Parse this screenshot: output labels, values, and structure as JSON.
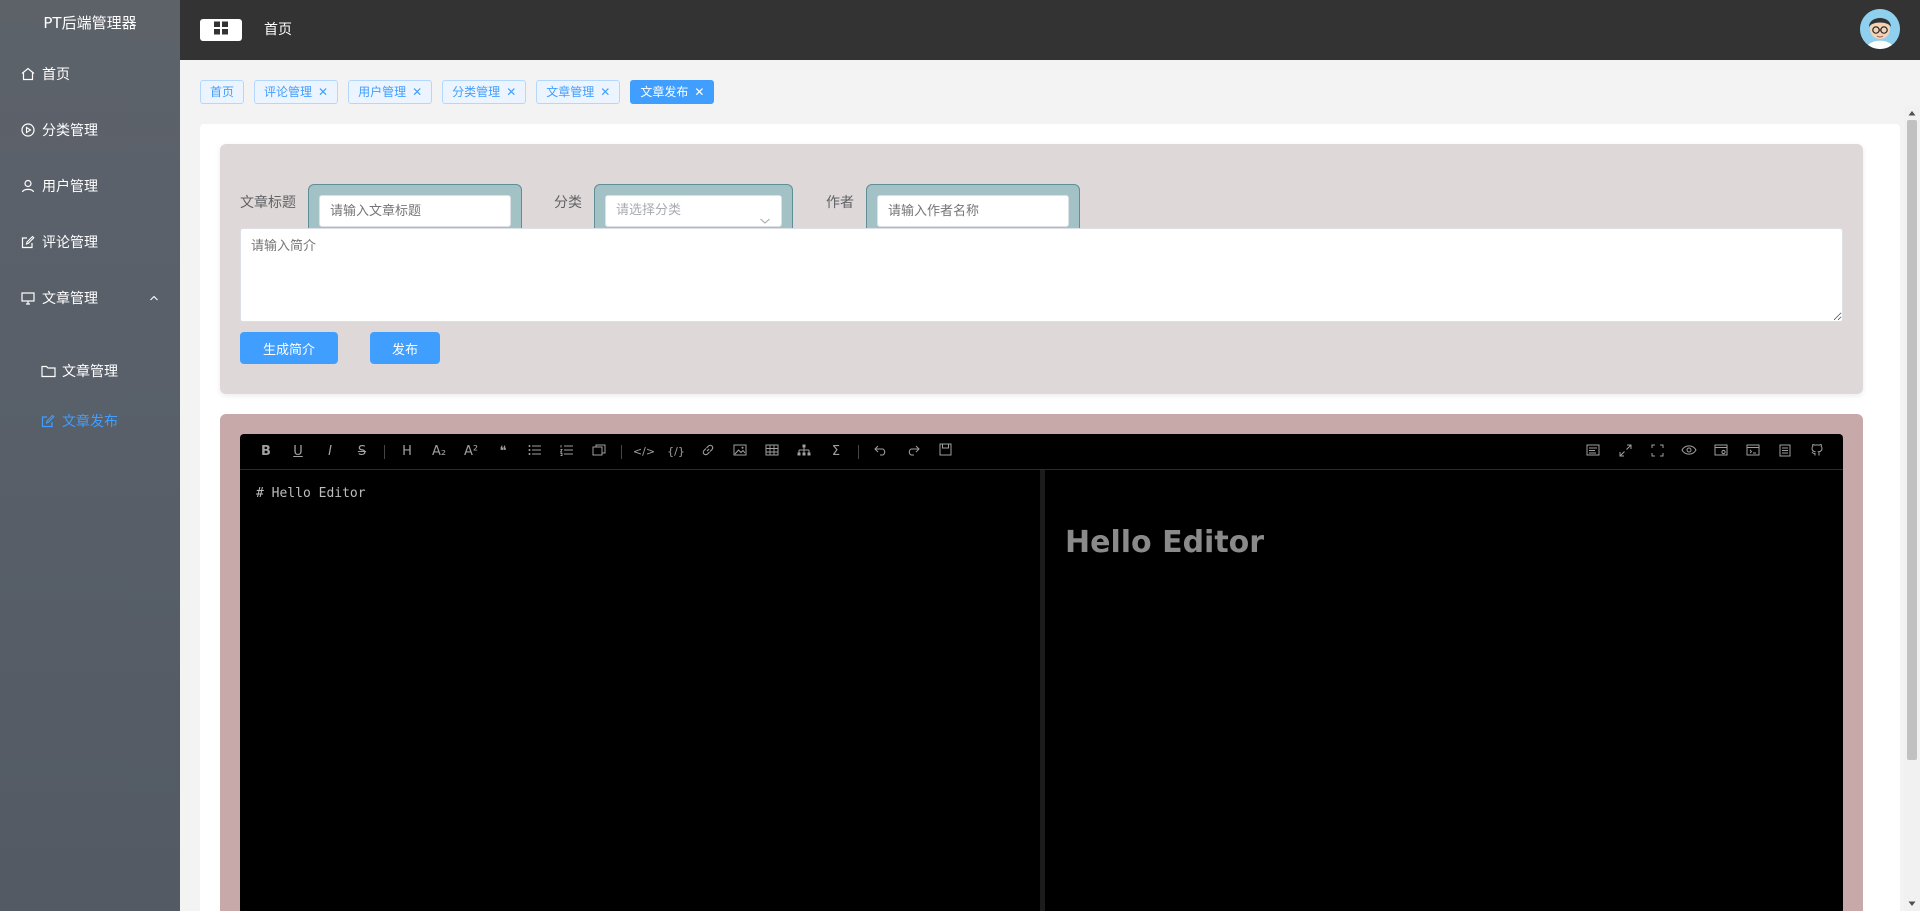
{
  "app": {
    "title": "PT后端管理器"
  },
  "sidebar": {
    "items": [
      {
        "label": "首页",
        "icon": "home-icon"
      },
      {
        "label": "分类管理",
        "icon": "play-circle-icon"
      },
      {
        "label": "用户管理",
        "icon": "user-icon"
      },
      {
        "label": "评论管理",
        "icon": "edit-icon"
      },
      {
        "label": "文章管理",
        "icon": "monitor-icon",
        "expanded": true
      }
    ],
    "subitems": [
      {
        "label": "文章管理",
        "icon": "folder-icon",
        "active": false
      },
      {
        "label": "文章发布",
        "icon": "edit-icon",
        "active": true
      }
    ]
  },
  "header": {
    "breadcrumb": "首页"
  },
  "tags": [
    {
      "label": "首页",
      "closable": false,
      "active": false
    },
    {
      "label": "评论管理",
      "closable": true,
      "active": false
    },
    {
      "label": "用户管理",
      "closable": true,
      "active": false
    },
    {
      "label": "分类管理",
      "closable": true,
      "active": false
    },
    {
      "label": "文章管理",
      "closable": true,
      "active": false
    },
    {
      "label": "文章发布",
      "closable": true,
      "active": true
    }
  ],
  "form": {
    "title_label": "文章标题",
    "title_placeholder": "请输入文章标题",
    "category_label": "分类",
    "category_placeholder": "请选择分类",
    "author_label": "作者",
    "author_placeholder": "请输入作者名称",
    "summary_placeholder": "请输入简介",
    "generate_button": "生成简介",
    "publish_button": "发布"
  },
  "editor": {
    "source": "# Hello Editor",
    "preview_heading": "Hello Editor"
  },
  "colors": {
    "accent": "#409eff",
    "header_bg": "#333333",
    "sidebar_bg": "#59606a",
    "form_card_bg": "#dfd8d8",
    "editor_card_bg": "#c8a9a9"
  }
}
